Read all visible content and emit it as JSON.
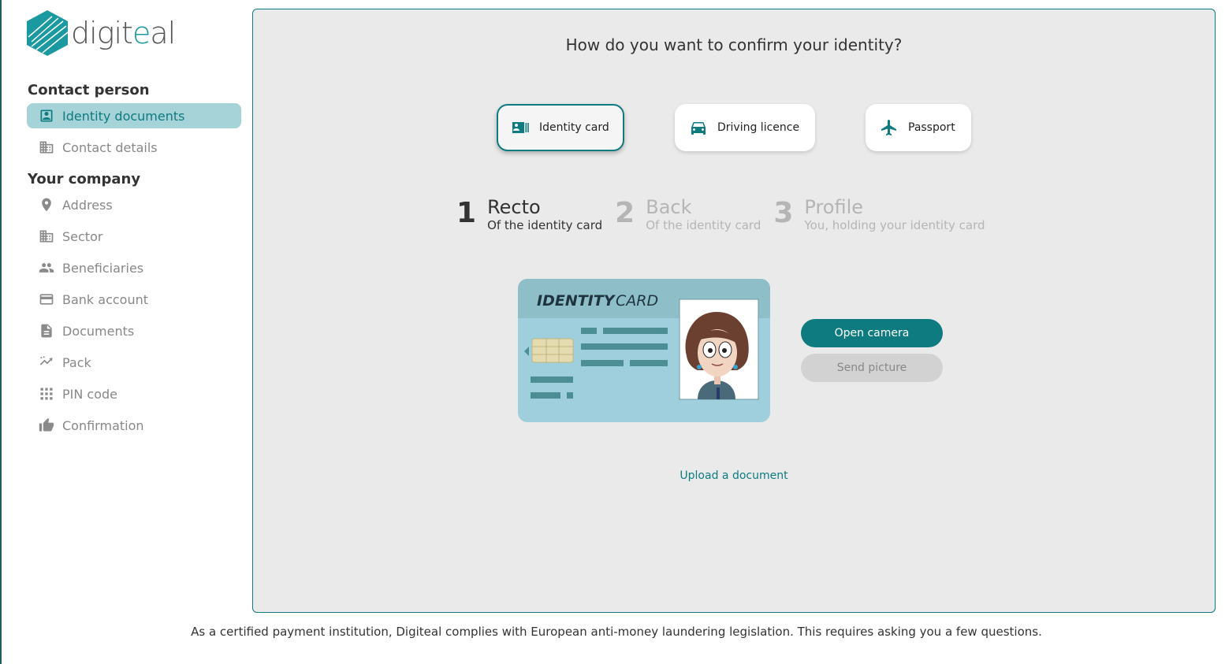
{
  "brand": {
    "name_part1": "digit",
    "name_accent": "e",
    "name_part2": "al",
    "logo_icon": "hexagon-logo-icon",
    "accent_color": "#0d7b80"
  },
  "sidebar": {
    "sections": [
      {
        "title": "Contact person",
        "items": [
          {
            "label": "Identity documents",
            "icon": "id-badge-icon",
            "active": true
          },
          {
            "label": "Contact details",
            "icon": "building-icon",
            "active": false
          }
        ]
      },
      {
        "title": "Your company",
        "items": [
          {
            "label": "Address",
            "icon": "location-pin-icon",
            "active": false
          },
          {
            "label": "Sector",
            "icon": "building-icon",
            "active": false
          },
          {
            "label": "Beneficiaries",
            "icon": "people-icon",
            "active": false
          },
          {
            "label": "Bank account",
            "icon": "credit-card-icon",
            "active": false
          },
          {
            "label": "Documents",
            "icon": "document-icon",
            "active": false
          },
          {
            "label": "Pack",
            "icon": "trending-icon",
            "active": false
          },
          {
            "label": "PIN code",
            "icon": "keypad-icon",
            "active": false
          },
          {
            "label": "Confirmation",
            "icon": "thumbs-up-icon",
            "active": false
          }
        ]
      }
    ]
  },
  "main": {
    "question": "How do you want to confirm your identity?",
    "doc_types": [
      {
        "label": "Identity card",
        "icon": "id-card-icon",
        "selected": true
      },
      {
        "label": "Driving licence",
        "icon": "car-icon",
        "selected": false
      },
      {
        "label": "Passport",
        "icon": "airplane-icon",
        "selected": false
      }
    ],
    "steps": [
      {
        "num": "1",
        "title": "Recto",
        "subtitle": "Of the identity card",
        "active": true
      },
      {
        "num": "2",
        "title": "Back",
        "subtitle": "Of the identity card",
        "active": false
      },
      {
        "num": "3",
        "title": "Profile",
        "subtitle": "You, holding your identity card",
        "active": false
      }
    ],
    "card_illustration": {
      "title_bold": "IDENTITY",
      "title_light": "CARD"
    },
    "open_camera_label": "Open camera",
    "send_picture_label": "Send picture",
    "upload_label": "Upload a document"
  },
  "footer": {
    "text": "As a certified payment institution, Digiteal complies with European anti-money laundering legislation. This requires asking you a few questions."
  }
}
